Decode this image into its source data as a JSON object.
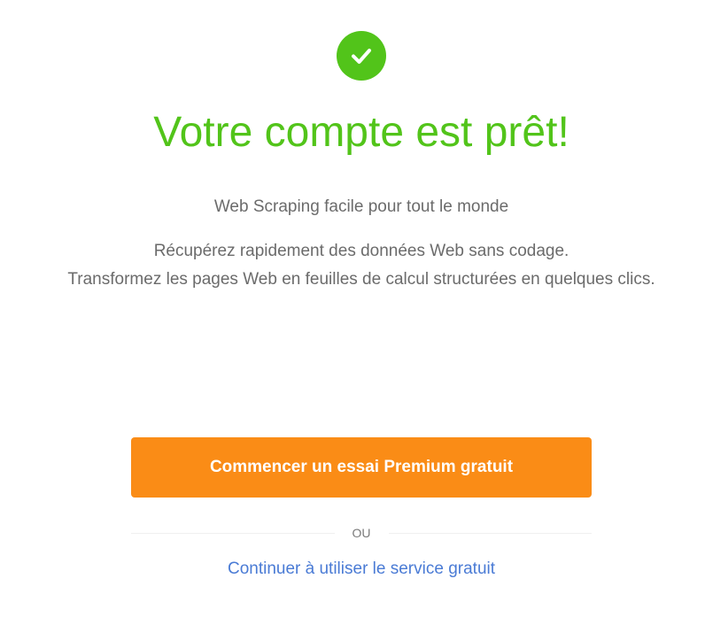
{
  "status": {
    "icon": "check-circle-icon",
    "color": "#52c41a"
  },
  "title": "Votre compte est prêt!",
  "subtitle": "Web Scraping facile pour tout le monde",
  "description": {
    "line1": "Récupérez rapidement des données Web sans codage.",
    "line2": "Transformez les pages Web en feuilles de calcul structurées en quelques clics."
  },
  "actions": {
    "premium_label": "Commencer un essai Premium gratuit",
    "premium_color": "#fa8c16",
    "divider_text": "OU",
    "free_label": "Continuer à utiliser le service gratuit",
    "free_color": "#4a7bd5"
  }
}
